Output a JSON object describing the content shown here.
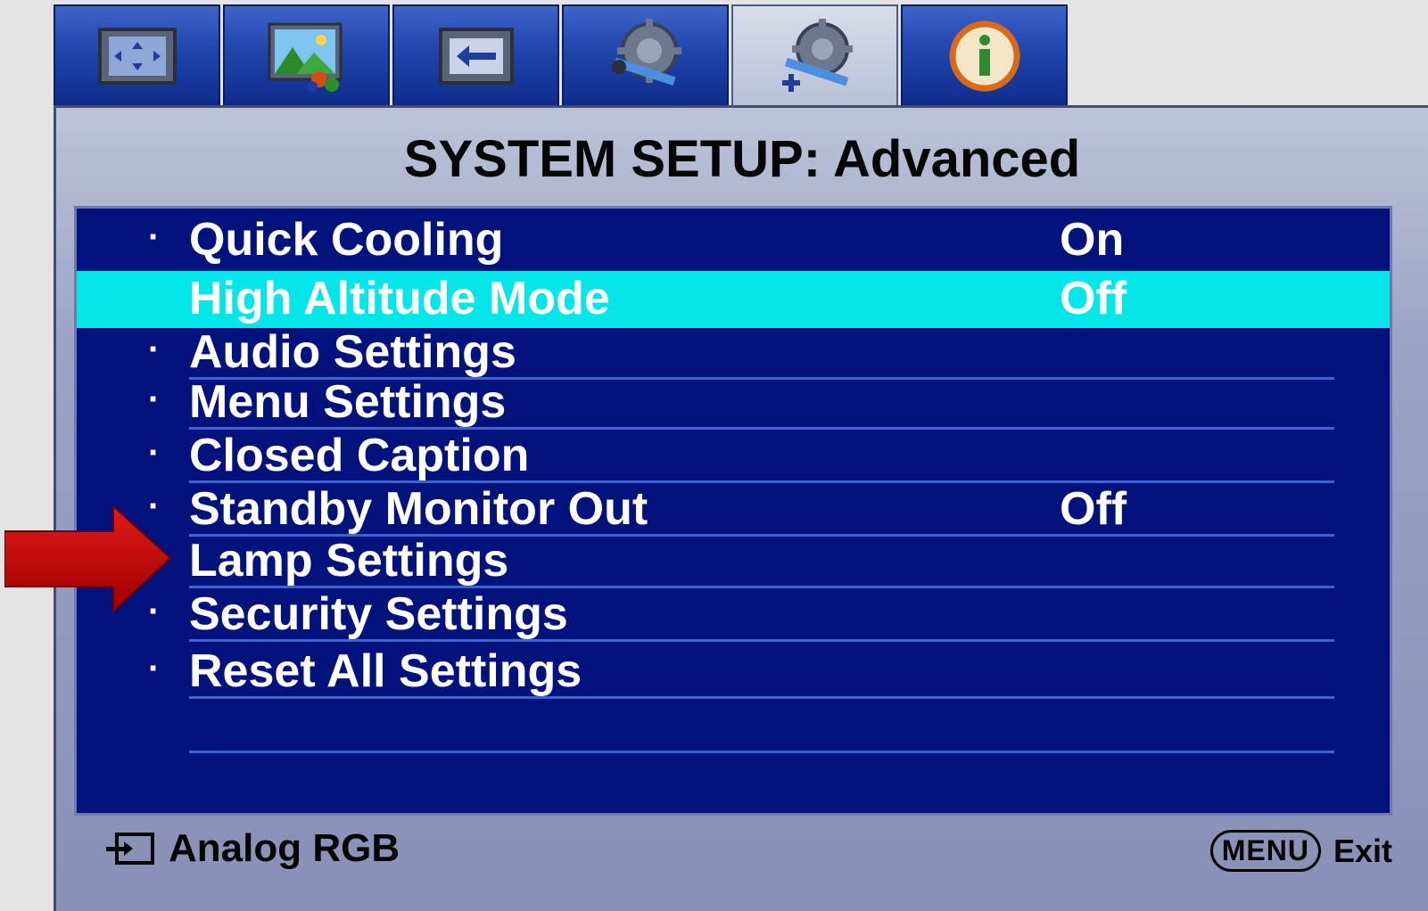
{
  "tabs": [
    {
      "icon": "picture-display-icon"
    },
    {
      "icon": "picture-advanced-icon"
    },
    {
      "icon": "source-input-icon"
    },
    {
      "icon": "system-setup-basic-icon"
    },
    {
      "icon": "system-setup-advanced-icon",
      "active": true
    },
    {
      "icon": "information-icon"
    }
  ],
  "menu": {
    "title": "SYSTEM SETUP: Advanced",
    "items": [
      {
        "label": "Quick Cooling",
        "value": "On"
      },
      {
        "label": "High Altitude Mode",
        "value": "Off",
        "highlighted": true
      },
      {
        "label": "Audio Settings",
        "value": ""
      },
      {
        "label": "Menu Settings",
        "value": ""
      },
      {
        "label": "Closed Caption",
        "value": ""
      },
      {
        "label": "Standby Monitor Out",
        "value": "Off"
      },
      {
        "label": "Lamp Settings",
        "value": ""
      },
      {
        "label": "Security Settings",
        "value": ""
      },
      {
        "label": "Reset All Settings",
        "value": ""
      }
    ]
  },
  "footer": {
    "source_label": "Analog RGB",
    "menu_key": "MENU",
    "exit_label": "Exit"
  },
  "colors": {
    "list_background": "#01127d",
    "highlight": "#05e6ea",
    "separator": "#3a63d6",
    "arrow": "#cc0000"
  }
}
